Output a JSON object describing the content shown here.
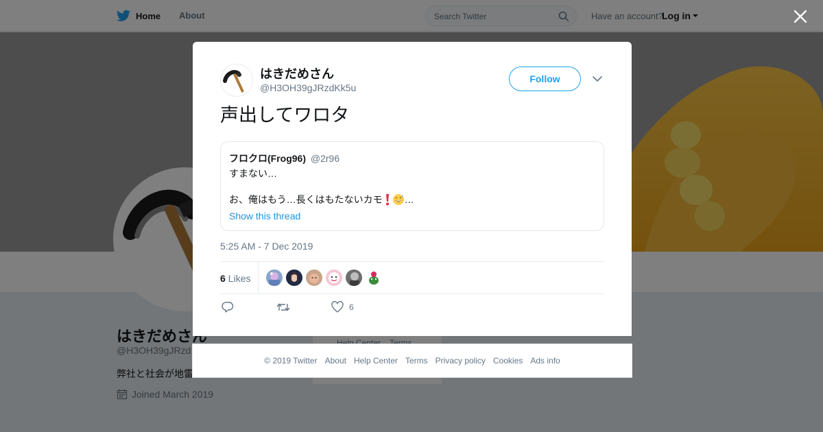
{
  "topbar": {
    "home_label": "Home",
    "about_label": "About",
    "search_placeholder": "Search Twitter",
    "have_account": "Have an account?",
    "login_label": "Log in"
  },
  "profile": {
    "name": "はきだめさん",
    "handle": "@H3OH39gJRzd",
    "bio": "弊社と社会が地雷",
    "joined": "Joined March 2019"
  },
  "background_footer": {
    "help_center": "Help Center",
    "terms": "Terms"
  },
  "tweet": {
    "user_name": "はきだめさん",
    "user_handle": "@H3OH39gJRzdKk5u",
    "follow_label": "Follow",
    "text": "声出してワロタ",
    "timestamp": "5:25 AM - 7 Dec 2019",
    "likes_count": "6",
    "likes_label": "Likes",
    "like_action_count": "6",
    "quoted": {
      "name": "フロクロ(Frog96)",
      "handle": "@2r96",
      "line1": "すまない…",
      "line2": "お、俺はもう…長くはもたないカモ",
      "line2_suffix": "…",
      "show_thread": "Show this thread"
    }
  },
  "footer": {
    "copyright": "© 2019 Twitter",
    "links": [
      "About",
      "Help Center",
      "Terms",
      "Privacy policy",
      "Cookies",
      "Ads info"
    ]
  },
  "colors": {
    "accent": "#1da1f2",
    "link": "#1b95e0",
    "muted": "#657786",
    "text": "#14171a",
    "banner_yellow": "#f7b733"
  }
}
